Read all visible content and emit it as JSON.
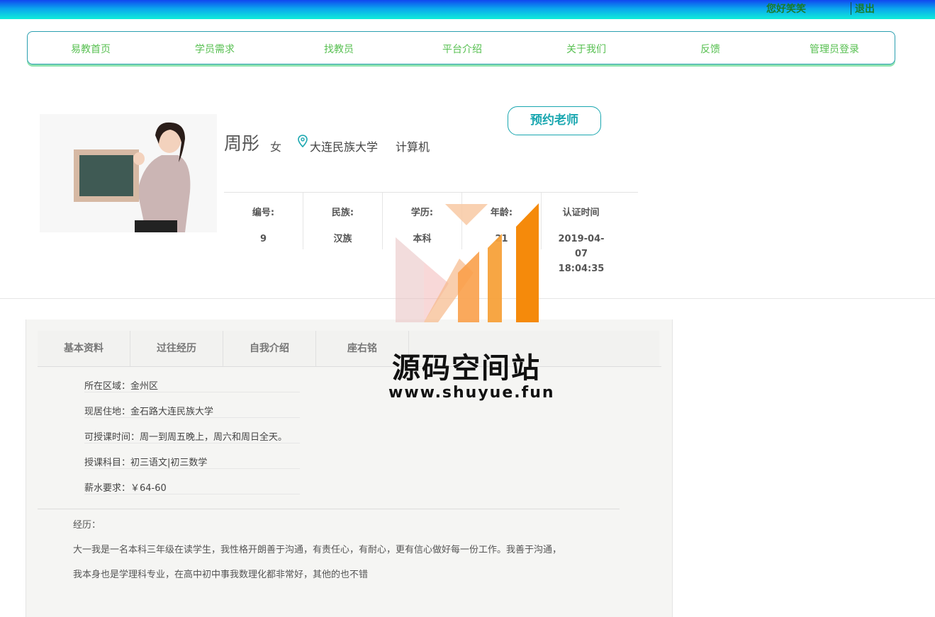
{
  "topbar": {
    "greeting": "您好笑笑",
    "logout": "退出"
  },
  "nav": {
    "items": [
      "易教首页",
      "学员需求",
      "找教员",
      "平台介绍",
      "关于我们",
      "反馈",
      "管理员登录"
    ]
  },
  "teacher": {
    "name": "周彤",
    "gender": "女",
    "school": "大连民族大学",
    "major": "计算机",
    "book_label": "预约老师"
  },
  "info": {
    "columns": [
      {
        "label": "编号:",
        "value": "9"
      },
      {
        "label": "民族:",
        "value": "汉族"
      },
      {
        "label": "学历:",
        "value": "本科"
      },
      {
        "label": "年龄:",
        "value": "21"
      },
      {
        "label": "认证时间",
        "value": "2019-04-07 18:04:35"
      }
    ]
  },
  "tabs": [
    "基本资料",
    "过往经历",
    "自我介绍",
    "座右铭"
  ],
  "basic": {
    "area": "所在区域：金州区",
    "address": "现居住地：金石路大连民族大学",
    "time": "可授课时间：周一到周五晚上，周六和周日全天。",
    "subjects": "授课科目：初三语文|初三数学",
    "salary": "薪水要求：￥64-60"
  },
  "experience": {
    "label": "经历：",
    "line1": "大一我是一名本科三年级在读学生，我性格开朗善于沟通，有责任心，有耐心，更有信心做好每一份工作。我善于沟通，",
    "line2": "我本身也是学理科专业，在高中初中事我数理化都非常好，其他的也不错"
  },
  "watermark": {
    "title": "源码空间站",
    "url": "www.shuyue.fun"
  },
  "colors": {
    "accent": "#1aa7b0",
    "nav_text": "#58c052",
    "greeting": "#1a7d2a",
    "watermark_orange": "#f58a0b"
  }
}
